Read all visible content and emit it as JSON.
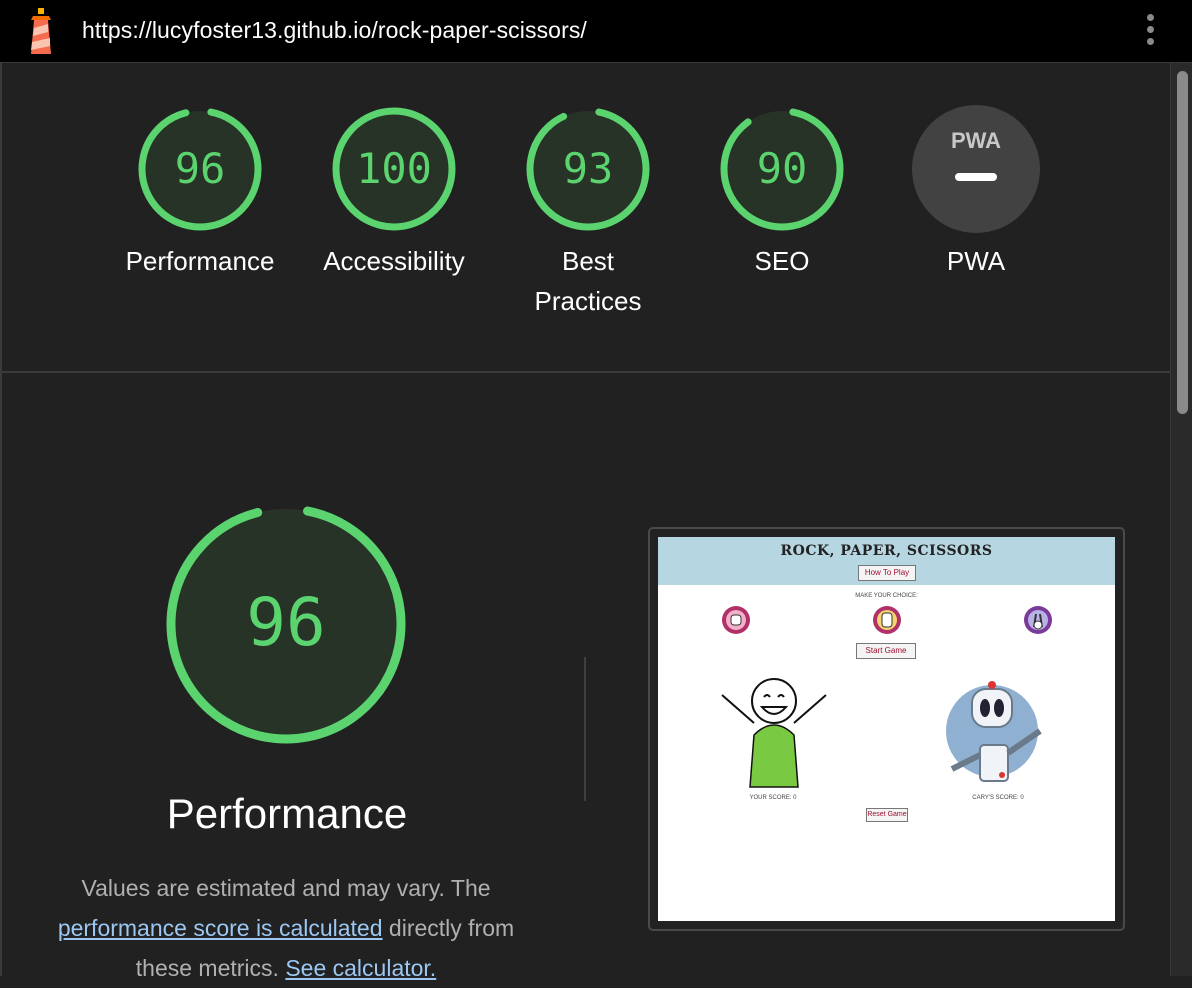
{
  "header": {
    "url": "https://lucyfoster13.github.io/rock-paper-scissors/",
    "menu_icon": "kebab-menu-icon"
  },
  "gauges": [
    {
      "label": "Performance",
      "score": "96",
      "value": 0.96,
      "color": "#5bd46f"
    },
    {
      "label": "Accessibility",
      "score": "100",
      "value": 1.0,
      "color": "#5bd46f"
    },
    {
      "label": "Best Practices",
      "score": "93",
      "value": 0.93,
      "color": "#5bd46f"
    },
    {
      "label": "SEO",
      "score": "90",
      "value": 0.9,
      "color": "#5bd46f"
    }
  ],
  "pwa": {
    "badge": "PWA",
    "label": "PWA"
  },
  "performance": {
    "score": "96",
    "value": 0.96,
    "title": "Performance",
    "desc_prefix": "Values are estimated and may vary. The",
    "desc_link": "performance score is calculated",
    "desc_mid": "directly from",
    "desc_line3": "these metrics.",
    "desc_link2": "See calculator."
  },
  "screenshot": {
    "title": "ROCK, PAPER, SCISSORS",
    "how_to_play": "How To Play",
    "make_choice": "MAKE YOUR CHOICE:",
    "start_game": "Start Game",
    "your_score": "YOUR SCORE: 0",
    "cary_score": "CARY'S SCORE: 0",
    "reset_game": "Reset Game"
  },
  "colors": {
    "pass": "#5bd46f",
    "gauge_bg": "#263326",
    "link": "#9bc7f2"
  }
}
